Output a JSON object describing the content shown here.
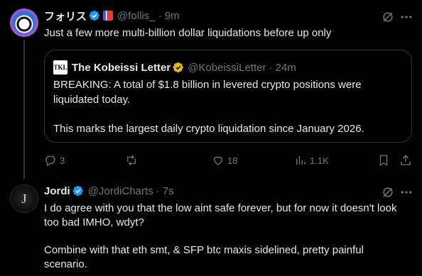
{
  "tweet1": {
    "name": "フォリス",
    "handle": "@follis_",
    "time": "· 9m",
    "text": "Just a few more multi-billion dollar liquidations before up only",
    "quote": {
      "logo_text": "TKL",
      "name": "The Kobeissi Letter",
      "handle": "@KobeissiLetter",
      "time": "· 24m",
      "line1": "BREAKING: A total of $1.8 billion in levered crypto positions were",
      "line2": "liquidated today.",
      "line3": "This marks the largest daily crypto liquidation since January 2026."
    },
    "actions": {
      "replies": "3",
      "reposts": "",
      "likes": "18",
      "views": "1.1K"
    }
  },
  "tweet2": {
    "name": "Jordi",
    "handle": "@JordiCharts",
    "time": "· 7s",
    "avatar_letter": "J",
    "line1": "I do agree with you that the low aint safe forever, but for now it doesn't look",
    "line2": "too bad IMHO, wdyt?",
    "line3": "Combine with that eth smt, & SFP btc maxis sidelined, pretty painful",
    "line4": "scenario."
  },
  "colors": {
    "background": "#000000",
    "text": "#e7e9ea",
    "muted": "#71767b",
    "verified_blue": "#1d9bf0",
    "verified_gold": "#e2b719",
    "border": "#2f3336"
  }
}
